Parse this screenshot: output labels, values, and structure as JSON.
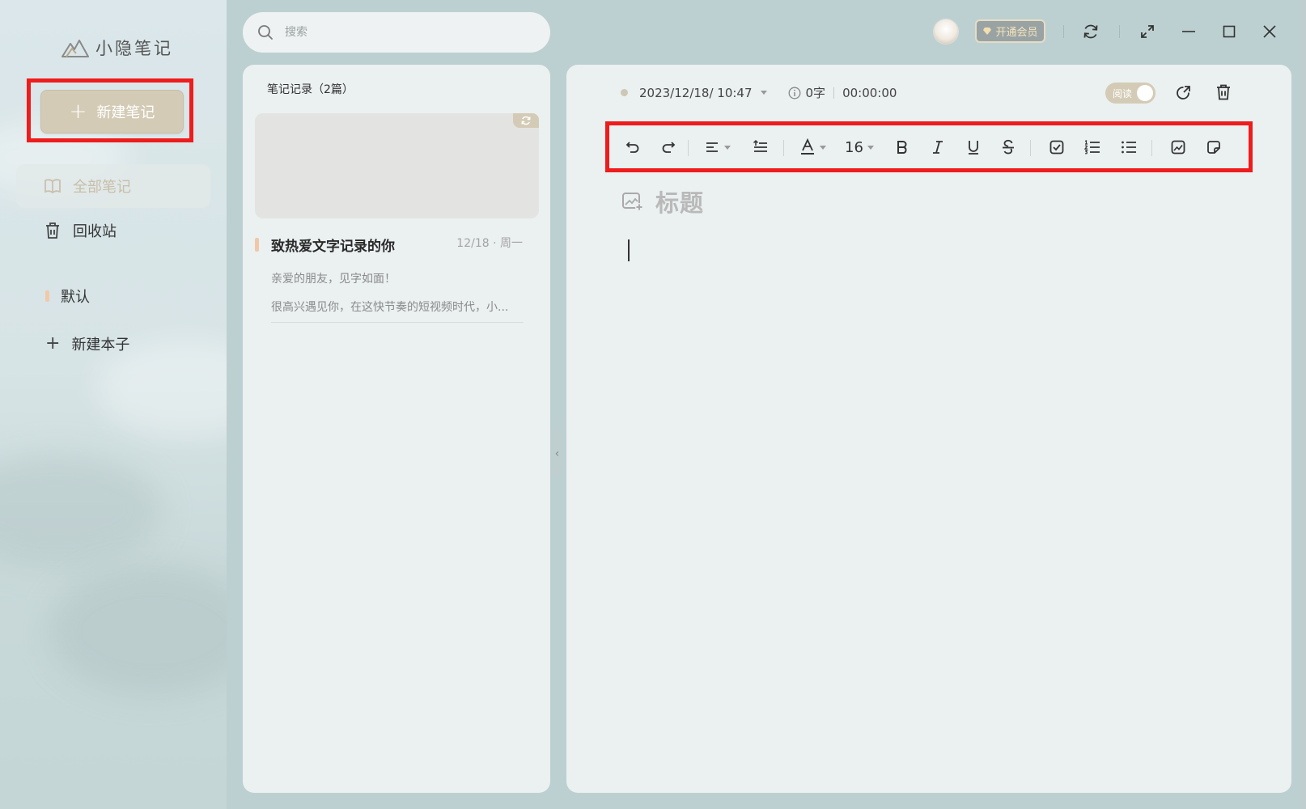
{
  "app": {
    "name": "小隐笔记"
  },
  "sidebar": {
    "new_note_label": "新建笔记",
    "items": [
      {
        "label": "全部笔记",
        "icon": "book-icon",
        "active": true
      },
      {
        "label": "回收站",
        "icon": "trash-icon",
        "active": false
      }
    ],
    "notebooks": [
      {
        "label": "默认",
        "color": "#f2c9a8"
      }
    ],
    "new_notebook_label": "新建本子"
  },
  "search": {
    "placeholder": "搜索"
  },
  "note_list": {
    "header": "笔记记录（2篇）",
    "notes": [
      {
        "title": "致热爱文字记录的你",
        "date": "12/18 · 周一",
        "line1": "亲爱的朋友，见字如面！",
        "line2": "很高兴遇见你，在这快节奏的短视频时代，小..."
      }
    ]
  },
  "window": {
    "vip_label": "开通会员"
  },
  "editor": {
    "datetime": "2023/12/18/ 10:47",
    "word_count": "0字",
    "timer": "00:00:00",
    "read_label": "阅读",
    "font_size": "16",
    "title_placeholder": "标题"
  },
  "colors": {
    "accent": "#d4cbb6",
    "highlight_border": "#ee1c1c",
    "notebook_marker": "#f2c9a8"
  }
}
